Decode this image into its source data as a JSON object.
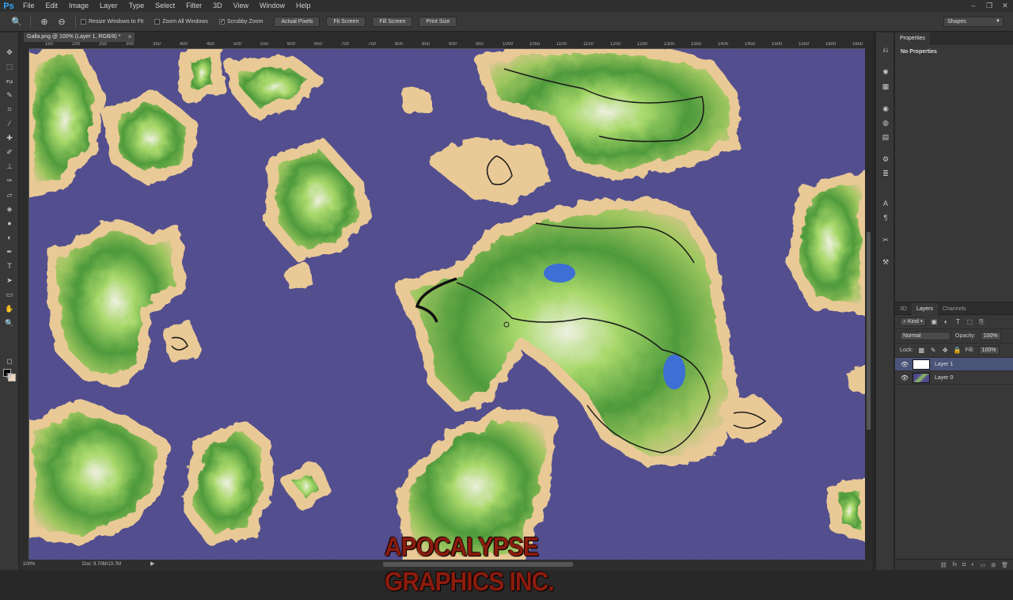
{
  "app": {
    "logo": "Ps"
  },
  "menu": [
    "File",
    "Edit",
    "Image",
    "Layer",
    "Type",
    "Select",
    "Filter",
    "3D",
    "View",
    "Window",
    "Help"
  ],
  "window_controls": [
    "–",
    "❐",
    "✕"
  ],
  "options_bar": {
    "checkboxes": [
      {
        "label": "Resize Windows to Fit",
        "checked": false
      },
      {
        "label": "Zoom All Windows",
        "checked": false
      },
      {
        "label": "Scrubby Zoom",
        "checked": true
      }
    ],
    "buttons": [
      "Actual Pixels",
      "Fit Screen",
      "Fill Screen",
      "Print Size"
    ],
    "workspace": "Shapes"
  },
  "document": {
    "tab_title": "Galla.png @ 100% (Layer 1, RGB/8) *",
    "ruler_ticks": [
      "150",
      "200",
      "250",
      "300",
      "350",
      "400",
      "450",
      "500",
      "550",
      "600",
      "650",
      "700",
      "750",
      "800",
      "850",
      "900",
      "950",
      "1000",
      "1050",
      "1100",
      "1150",
      "1200",
      "1250",
      "1300",
      "1350",
      "1400",
      "1450",
      "1500",
      "1550",
      "1600",
      "1650"
    ],
    "zoom": "100%",
    "doc_size": "Doc: 9.70M/13.7M",
    "ocean_color": "#4f4a8c"
  },
  "watermark": "APOCALYPSE GRAPHICS INC.",
  "properties": {
    "tab": "Properties",
    "body": "No Properties"
  },
  "layers_panel": {
    "tabs": [
      "3D",
      "Layers",
      "Channels"
    ],
    "filter": "Kind",
    "blend_mode": "Normal",
    "opacity_label": "Opacity:",
    "opacity": "100%",
    "lock_label": "Lock:",
    "fill_label": "Fill:",
    "fill": "100%",
    "layers": [
      {
        "name": "Layer 1",
        "selected": true
      },
      {
        "name": "Layer 0",
        "selected": false
      }
    ]
  },
  "colors": {
    "foreground": "#000000",
    "background": "#f2d7b8",
    "selection": "#4a5478"
  }
}
